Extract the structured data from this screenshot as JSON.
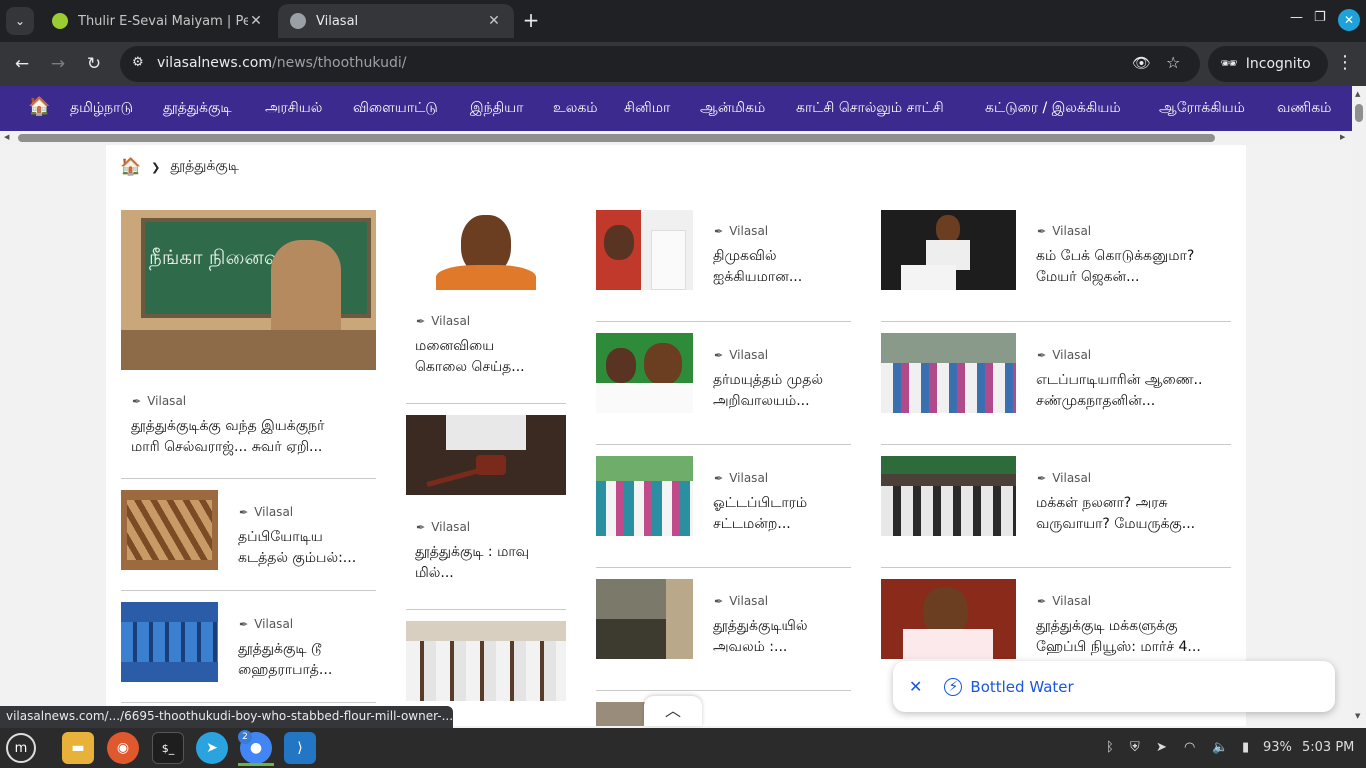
{
  "browser": {
    "tabs": [
      {
        "title": "Thulir E-Sevai Maiyam | Peran",
        "favicon": "lime-globe-icon",
        "active": false
      },
      {
        "title": "Vilasal",
        "favicon": "globe-icon",
        "active": true
      }
    ],
    "url_host": "vilasalnews.com",
    "url_path": "/news/thoothukudi/",
    "profile_label": "Incognito",
    "status_url": "vilasalnews.com/.../6695-thoothukudi-boy-who-stabbed-flour-mill-owner-..."
  },
  "site": {
    "nav": [
      "தமிழ்நாடு",
      "தூத்துக்குடி",
      "அரசியல்",
      "விளையாட்டு",
      "இந்தியா",
      "உலகம்",
      "சினிமா",
      "ஆன்மிகம்",
      "காட்சி சொல்லும் சாட்சி",
      "கட்டுரை / இலக்கியம்",
      "ஆரோக்கியம்",
      "வணிகம்"
    ],
    "breadcrumb": "தூத்துக்குடி",
    "nav_bg": "#3d2a8f"
  },
  "articles": {
    "col1": [
      {
        "source": "Vilasal",
        "title1": "தூத்துக்குடிக்கு வந்த இயக்குநர்",
        "title2": "மாரி செல்வராஜ்... சுவர் ஏறி...",
        "board_text": "நீங்கா நினைவுகள்"
      },
      {
        "source": "Vilasal",
        "title1": "தப்பியோடிய",
        "title2": "கடத்தல் கும்பல்:..."
      },
      {
        "source": "Vilasal",
        "title1": "தூத்துக்குடி டூ",
        "title2": "ஹைதராபாத்..."
      }
    ],
    "col2": [
      {
        "source": "Vilasal",
        "title1": "மனைவியை",
        "title2": "கொலை செய்த..."
      },
      {
        "source": "Vilasal",
        "title1": "தூத்துக்குடி : மாவு",
        "title2": "மில்..."
      }
    ],
    "col3": [
      {
        "source": "Vilasal",
        "title1": "திமுகவில்",
        "title2": "ஐக்கியமான..."
      },
      {
        "source": "Vilasal",
        "title1": "தர்மயுத்தம் முதல்",
        "title2": "அறிவாலயம்..."
      },
      {
        "source": "Vilasal",
        "title1": "ஓட்டப்பிடாரம்",
        "title2": "சட்டமன்ற..."
      },
      {
        "source": "Vilasal",
        "title1": "தூத்துக்குடியில்",
        "title2": "அவலம் :..."
      }
    ],
    "col4": [
      {
        "source": "Vilasal",
        "title1": "கம் பேக் கொடுக்கனுமா?",
        "title2": "மேயர் ஜெகன்..."
      },
      {
        "source": "Vilasal",
        "title1": "எடப்பாடியாரின் ஆணை..",
        "title2": "சண்முகநாதனின்..."
      },
      {
        "source": "Vilasal",
        "title1": "மக்கள் நலனா? அரசு",
        "title2": "வருவாயா? மேயருக்கு..."
      },
      {
        "source": "Vilasal",
        "title1": "தூத்துக்குடி மக்களுக்கு",
        "title2": "ஹேப்பி நியூஸ்: மார்ச் 4..."
      }
    ]
  },
  "toast": {
    "label": "Bottled Water"
  },
  "taskbar": {
    "chrome_badge": "2",
    "battery": "93%",
    "time": "5:03 PM"
  }
}
